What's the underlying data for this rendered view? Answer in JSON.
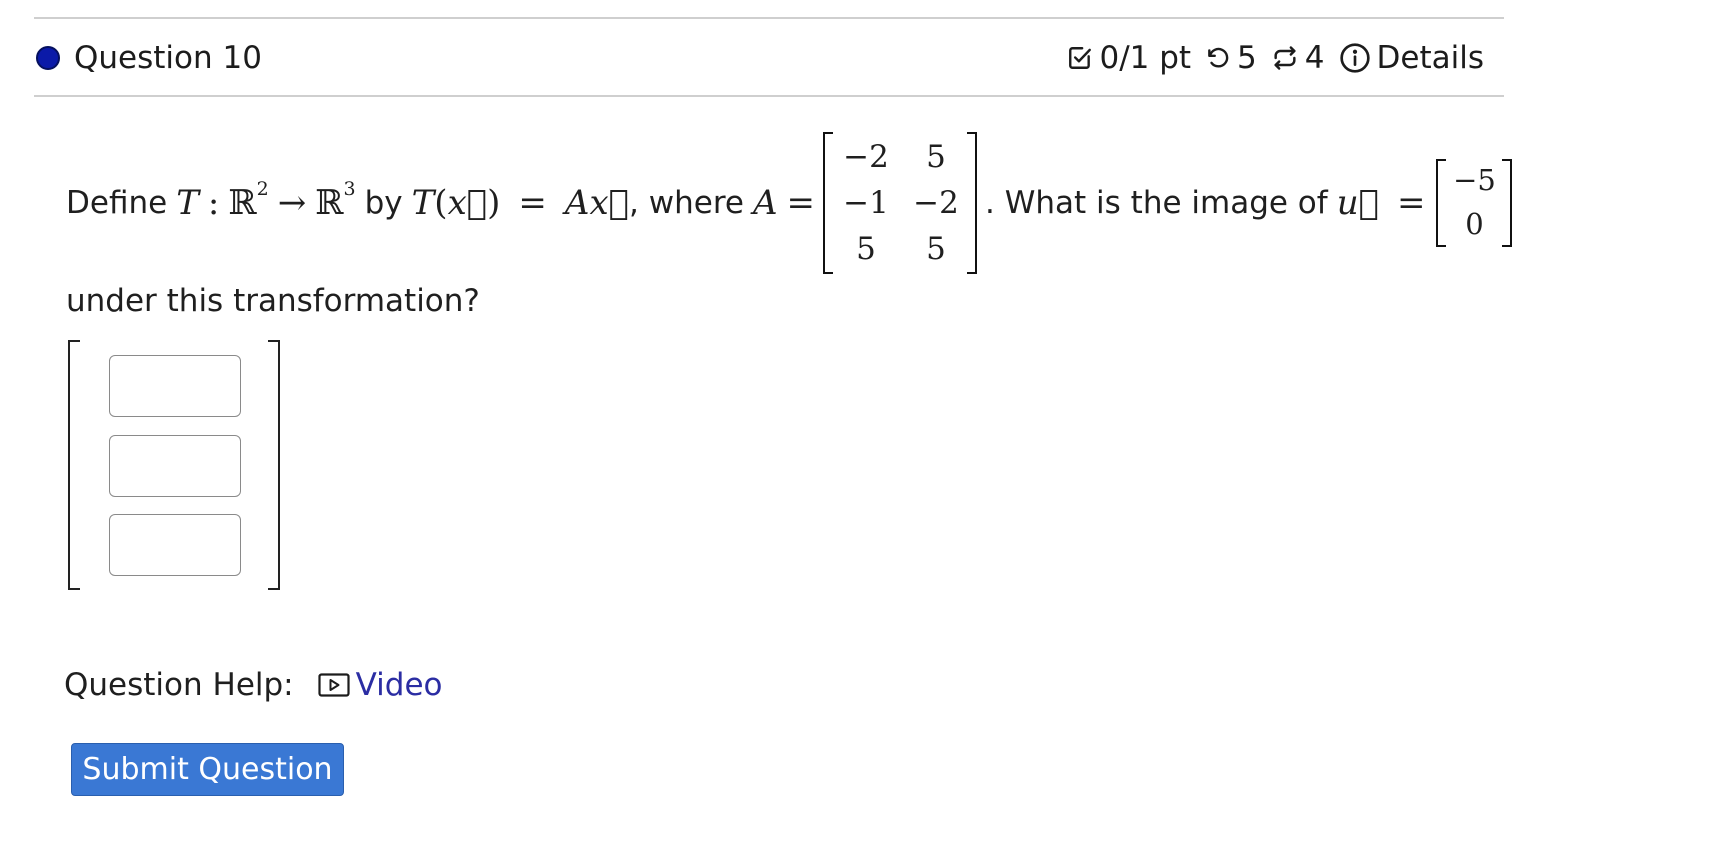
{
  "question": {
    "title": "Question 10",
    "status_color": "#0b1aa8"
  },
  "meta": {
    "score": "0/1 pt",
    "retries": "5",
    "attempts": "4",
    "details_label": "Details",
    "icons": [
      "check-square-icon",
      "undo-icon",
      "repeat-icon",
      "info-icon"
    ]
  },
  "prompt": {
    "define": "Define",
    "T": "T",
    "colon": ":",
    "R": "ℝ",
    "dim_domain": "2",
    "arrow": "→",
    "dim_codomain": "3",
    "by": "by",
    "lhs": "T",
    "x": "x⃗",
    "eq": "=",
    "rhs": "Ax⃗",
    "where": ", where",
    "A": "A",
    "matrix_A": [
      [
        "−2",
        "5"
      ],
      [
        "−1",
        "−2"
      ],
      [
        "5",
        "5"
      ]
    ],
    "question_part": ". What is the image of",
    "u": "u⃗",
    "vector_u": [
      "−5",
      "0"
    ],
    "line2": "under this transformation?"
  },
  "answer": {
    "input_values": [
      "",
      "",
      ""
    ]
  },
  "help": {
    "label": "Question Help:",
    "video_label": "Video",
    "link_color": "#2b2da3"
  },
  "submit": {
    "label": "Submit Question",
    "color": "#3a78d4"
  }
}
